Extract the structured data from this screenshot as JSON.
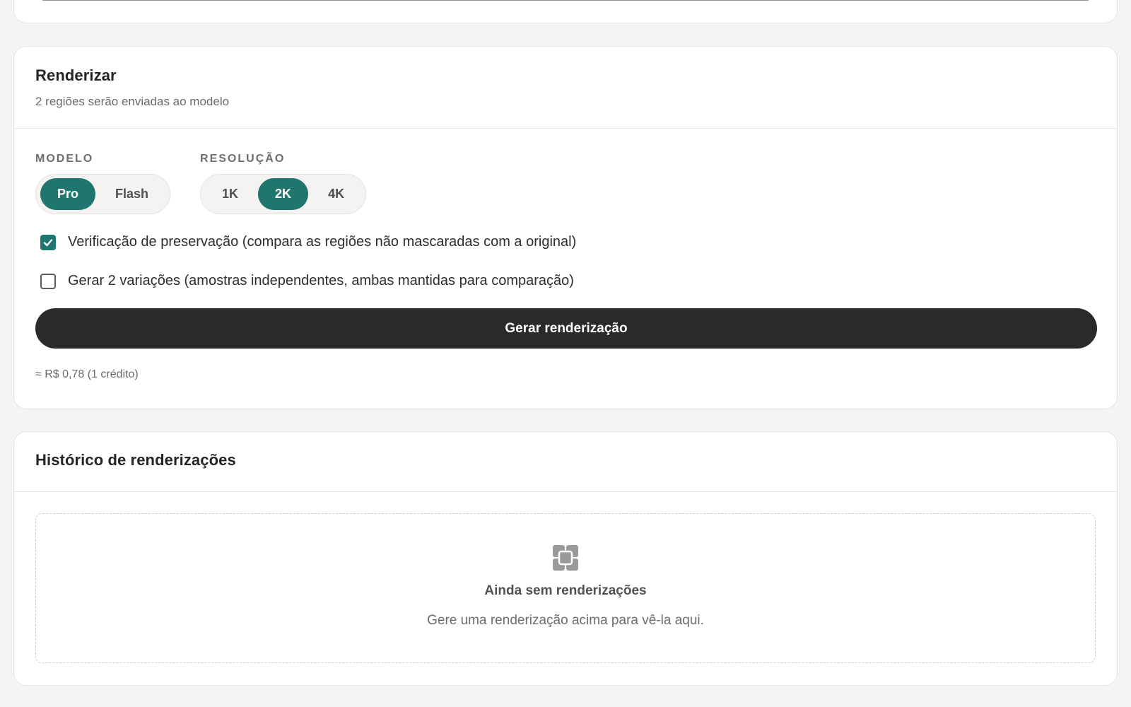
{
  "render": {
    "title": "Renderizar",
    "subtitle": "2 regiões serão enviadas ao modelo",
    "model": {
      "label": "MODELO",
      "options": [
        "Pro",
        "Flash"
      ],
      "selected": "Pro"
    },
    "resolution": {
      "label": "RESOLUÇÃO",
      "options": [
        "1K",
        "2K",
        "4K"
      ],
      "selected": "2K"
    },
    "preservation_check": {
      "label": "Verificação de preservação (compara as regiões não mascaradas com a original)",
      "checked": true
    },
    "variations_check": {
      "label": "Gerar 2 variações (amostras independentes, ambas mantidas para comparação)",
      "checked": false
    },
    "generate_label": "Gerar renderização",
    "cost": "≈ R$ 0,78 (1 crédito)"
  },
  "history": {
    "title": "Histórico de renderizações",
    "empty_icon": "render-stack-icon",
    "empty_title": "Ainda sem renderizações",
    "empty_text": "Gere uma renderização acima para vê-la aqui."
  },
  "colors": {
    "accent": "#1f766f",
    "primary_button": "#2a2a2a",
    "background": "#f5f4f2"
  }
}
